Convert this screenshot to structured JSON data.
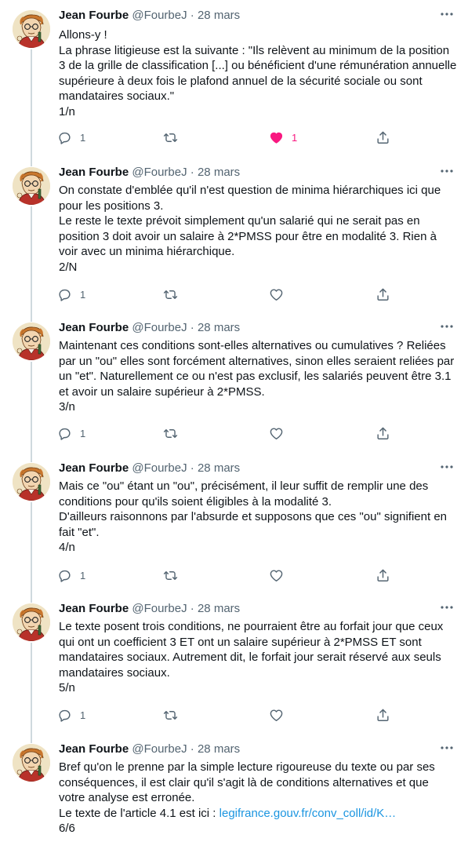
{
  "tweets": [
    {
      "name": "Jean Fourbe",
      "handle": "@FourbeJ",
      "date": "28 mars",
      "lines": [
        "Allons-y !",
        "La phrase litigieuse est la suivante  : \"Ils relèvent au minimum de la position 3 de la grille de classification [...] ou bénéficient d'une rémunération annuelle supérieure à deux fois le plafond annuel de la sécurité sociale ou sont mandataires sociaux.\"",
        "1/n"
      ],
      "reply_count": "1",
      "like_count": "1",
      "liked": true
    },
    {
      "name": "Jean Fourbe",
      "handle": "@FourbeJ",
      "date": "28 mars",
      "lines": [
        "On constate d'emblée qu'il n'est question de minima hiérarchiques ici que pour les positions 3.",
        "Le reste le texte prévoit simplement qu'un salarié qui ne serait pas en position 3 doit avoir un salaire à 2*PMSS pour être en modalité 3. Rien à voir avec un minima hiérarchique.",
        "2/N"
      ],
      "reply_count": "1",
      "like_count": "",
      "liked": false
    },
    {
      "name": "Jean Fourbe",
      "handle": "@FourbeJ",
      "date": "28 mars",
      "lines": [
        "Maintenant ces conditions sont-elles alternatives ou cumulatives ? Reliées par un \"ou\" elles sont forcément alternatives, sinon elles seraient reliées par un \"et\". Naturellement ce ou n'est pas exclusif, les salariés peuvent être 3.1 et avoir un salaire supérieur à 2*PMSS.",
        "3/n"
      ],
      "reply_count": "1",
      "like_count": "",
      "liked": false
    },
    {
      "name": "Jean Fourbe",
      "handle": "@FourbeJ",
      "date": "28 mars",
      "lines": [
        "Mais ce \"ou\" étant un \"ou\", précisément, il leur suffit de remplir une des conditions pour qu'ils soient éligibles à la modalité 3.",
        "D'ailleurs raisonnons par l'absurde et supposons que ces \"ou\" signifient en fait \"et\".",
        "4/n"
      ],
      "reply_count": "1",
      "like_count": "",
      "liked": false
    },
    {
      "name": "Jean Fourbe",
      "handle": "@FourbeJ",
      "date": "28 mars",
      "lines": [
        "Le texte posent trois conditions, ne pourraient être au forfait jour que ceux qui ont un coefficient 3 ET ont un salaire supérieur à 2*PMSS ET sont mandataires sociaux. Autrement dit, le forfait jour serait réservé aux seuls mandataires sociaux.",
        "5/n"
      ],
      "reply_count": "1",
      "like_count": "",
      "liked": false
    },
    {
      "name": "Jean Fourbe",
      "handle": "@FourbeJ",
      "date": "28 mars",
      "lines": [
        "Bref qu'on le prenne par la simple lecture rigoureuse du texte ou par ses conséquences, il est clair qu'il s'agit là de conditions alternatives et que votre analyse est erronée.",
        "Le texte de l'article 4.1 est ici : ",
        "6/6"
      ],
      "link_text": "legifrance.gouv.fr/conv_coll/id/K…",
      "reply_count": "",
      "like_count": "",
      "liked": false
    }
  ],
  "icons": {
    "reply": "reply-icon",
    "retweet": "retweet-icon",
    "like": "heart-icon",
    "share": "share-icon",
    "more": "more-icon"
  },
  "colors": {
    "text": "#0f1419",
    "muted": "#536471",
    "link": "#1b95e0",
    "like_active": "#f91880",
    "thread_line": "#cfd9de"
  }
}
